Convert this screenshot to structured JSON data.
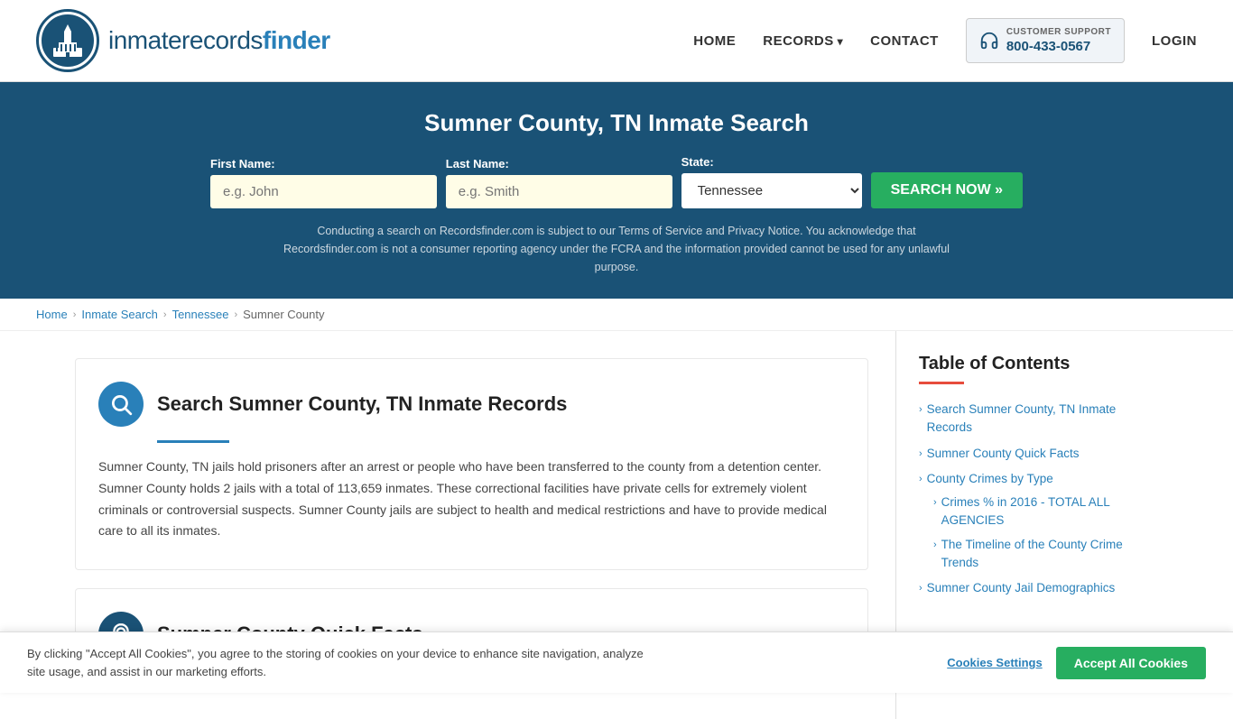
{
  "header": {
    "logo_text_main": "inmaterecords",
    "logo_text_bold": "finder",
    "nav": {
      "home": "HOME",
      "records": "RECORDS",
      "contact": "CONTACT",
      "support_label": "CUSTOMER SUPPORT",
      "support_number": "800-433-0567",
      "login": "LOGIN"
    }
  },
  "hero": {
    "title": "Sumner County, TN Inmate Search",
    "first_name_label": "First Name:",
    "first_name_placeholder": "e.g. John",
    "last_name_label": "Last Name:",
    "last_name_placeholder": "e.g. Smith",
    "state_label": "State:",
    "state_value": "Tennessee",
    "search_button": "SEARCH NOW »",
    "disclaimer": "Conducting a search on Recordsfinder.com is subject to our Terms of Service and Privacy Notice. You acknowledge that Recordsfinder.com is not a consumer reporting agency under the FCRA and the information provided cannot be used for any unlawful purpose."
  },
  "breadcrumb": {
    "items": [
      "Home",
      "Inmate Search",
      "Tennessee",
      "Sumner County"
    ]
  },
  "main": {
    "section1": {
      "title": "Search Sumner County, TN Inmate Records",
      "body": "Sumner County, TN jails hold prisoners after an arrest or people who have been transferred to the county from a detention center. Sumner County holds 2 jails with a total of 113,659 inmates. These correctional facilities have private cells for extremely violent criminals or controversial suspects. Sumner County jails are subject to health and medical restrictions and have to provide medical care to all its inmates."
    },
    "section2": {
      "title": "Sumner County Quick Facts"
    }
  },
  "toc": {
    "title": "Table of Contents",
    "items": [
      {
        "label": "Search Sumner County, TN Inmate Records",
        "sub": []
      },
      {
        "label": "Sumner County Quick Facts",
        "sub": []
      },
      {
        "label": "County Crimes by Type",
        "sub": [
          "Crimes % in 2016 - TOTAL ALL AGENCIES",
          "The Timeline of the County Crime Trends"
        ]
      },
      {
        "label": "Sumner County Jail Demographics",
        "sub": []
      }
    ]
  },
  "cookie": {
    "text": "By clicking \"Accept All Cookies\", you agree to the storing of cookies on your device to enhance site navigation, analyze site usage, and assist in our marketing efforts.",
    "settings_label": "Cookies Settings",
    "accept_label": "Accept All Cookies"
  }
}
